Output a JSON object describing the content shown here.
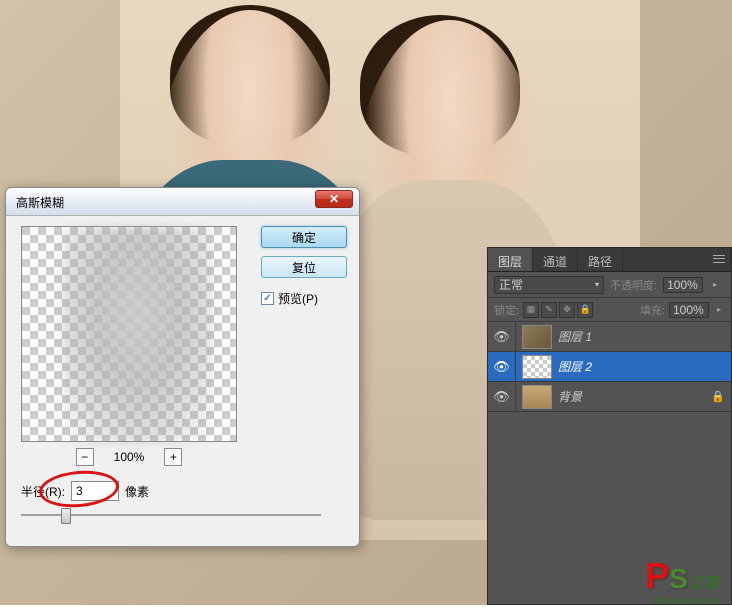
{
  "dialog": {
    "title": "高斯模糊",
    "ok_label": "确定",
    "reset_label": "复位",
    "preview_label": "预览(P)",
    "zoom_value": "100%",
    "zoom_minus": "−",
    "zoom_plus": "+",
    "radius_label": "半径(R):",
    "radius_value": "3",
    "radius_unit": "像素",
    "close_icon": "✕"
  },
  "layers_panel": {
    "tabs": {
      "layers": "图层",
      "channels": "通道",
      "paths": "路径"
    },
    "blend_mode": "正常",
    "opacity_label": "不透明度:",
    "opacity_value": "100%",
    "lock_label": "锁定:",
    "fill_label": "填充:",
    "fill_value": "100%",
    "layers": [
      {
        "name": "图层 1",
        "visible": true,
        "selected": false,
        "thumb": "photo"
      },
      {
        "name": "图层 2",
        "visible": true,
        "selected": true,
        "thumb": "checker"
      },
      {
        "name": "背景",
        "visible": true,
        "selected": false,
        "thumb": "bg",
        "locked": true
      }
    ]
  },
  "watermark": {
    "p": "P",
    "s": "S",
    "text": "之家",
    "url": "Phome.com.cn"
  }
}
